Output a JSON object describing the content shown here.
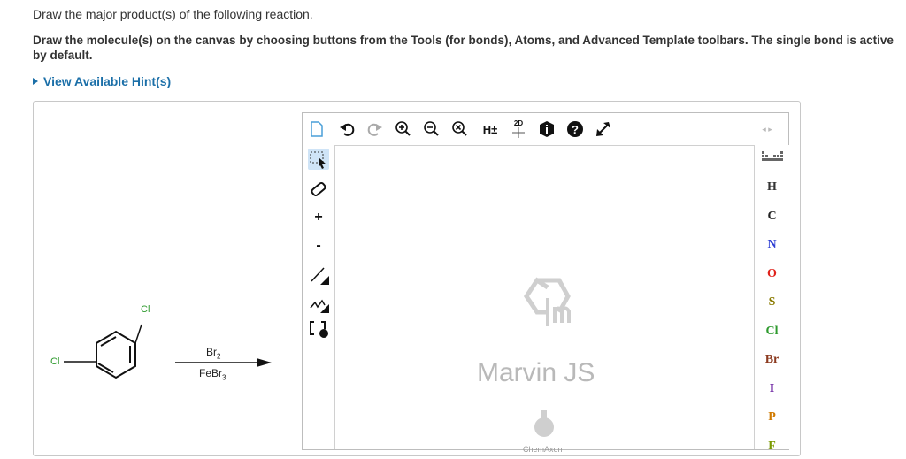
{
  "question": {
    "prompt": "Draw the major product(s) of the following reaction.",
    "instructions": "Draw the molecule(s) on the canvas by choosing buttons from the Tools (for bonds), Atoms, and Advanced Template toolbars. The single bond is active by default.",
    "hint_link": "View Available Hint(s)"
  },
  "reaction": {
    "substituent_top": "Cl",
    "substituent_left": "Cl",
    "reagent_top": "Br",
    "reagent_top_sub": "2",
    "reagent_bottom": "FeBr",
    "reagent_bottom_sub": "3"
  },
  "editor": {
    "top_toolbar": {
      "hydrogen_toggle_label": "H±",
      "clean_2d_label": "2D"
    },
    "left_toolbar": {
      "charge_plus": "+",
      "charge_minus": "-"
    },
    "atoms": [
      "H",
      "C",
      "N",
      "O",
      "S",
      "Cl",
      "Br",
      "I",
      "P",
      "F"
    ],
    "atom_colors": {
      "H": "#333333",
      "C": "#222222",
      "N": "#2f3fd3",
      "O": "#e0221b",
      "S": "#8a7a00",
      "Cl": "#2e9a2e",
      "Br": "#8b3a1f",
      "I": "#6a1fa0",
      "P": "#d07a00",
      "F": "#7a9a00"
    },
    "watermark": {
      "title": "Marvin JS",
      "subtitle": "ChemAxon"
    }
  }
}
